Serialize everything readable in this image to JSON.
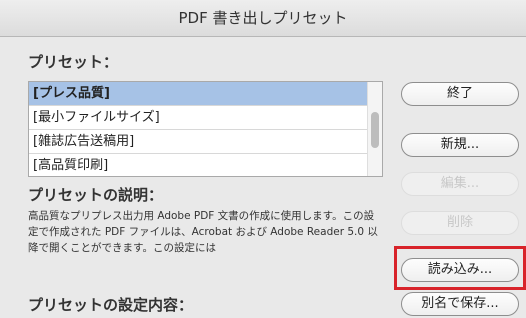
{
  "window": {
    "title": "PDF 書き出しプリセット"
  },
  "presets": {
    "label": "プリセット：",
    "items": [
      {
        "label": "[プレス品質]"
      },
      {
        "label": "[最小ファイルサイズ]"
      },
      {
        "label": "[雑誌広告送稿用]"
      },
      {
        "label": "[高品質印刷]"
      }
    ],
    "selected_index": 0
  },
  "description": {
    "label": "プリセットの説明：",
    "text": "高品質なプリプレス出力用 Adobe PDF 文書の作成に使用します。この設定で作成された PDF ファイルは、Acrobat および Adobe Reader 5.0 以降で開くことができます。この設定には"
  },
  "settings": {
    "label": "プリセットの設定内容："
  },
  "buttons": {
    "done": "終了",
    "new": "新規...",
    "edit": "編集...",
    "delete": "削除",
    "load": "読み込み...",
    "save_as": "別名で保存..."
  },
  "colors": {
    "highlight": "#d8232a",
    "selection": "#a6c2e6"
  }
}
